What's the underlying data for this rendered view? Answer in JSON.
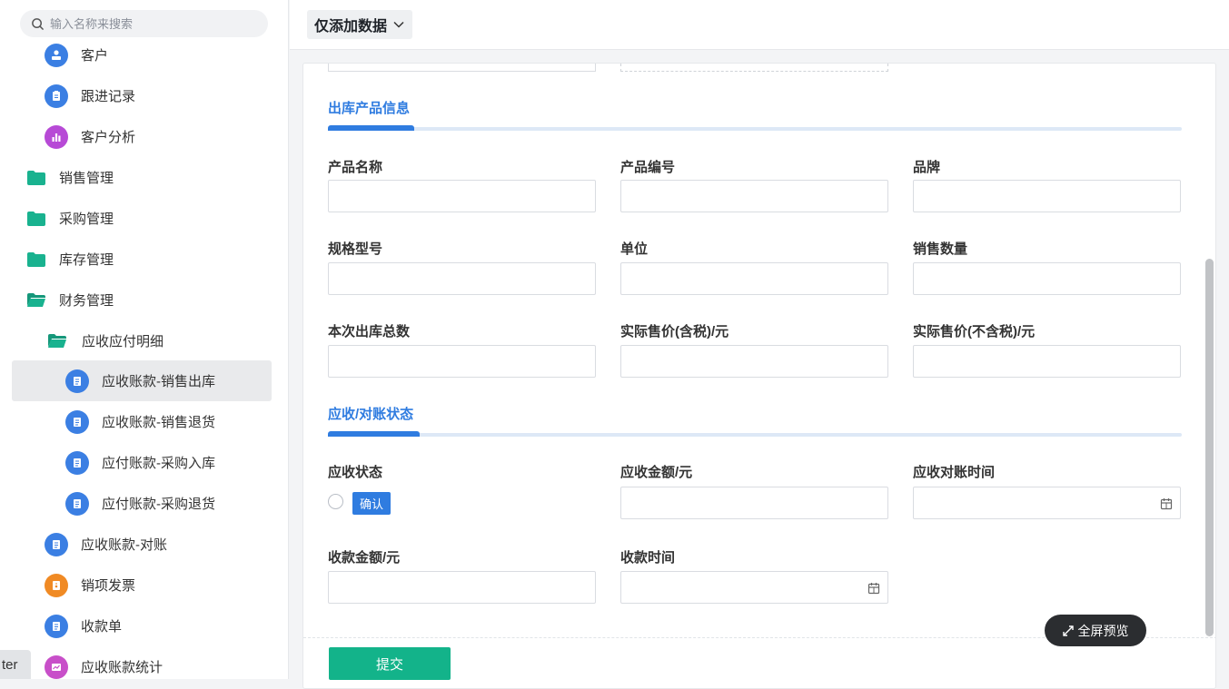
{
  "sidebar": {
    "search_placeholder": "输入名称来搜索",
    "items": [
      {
        "label": "客户",
        "icon": "customer-icon"
      },
      {
        "label": "跟进记录",
        "icon": "clipboard-icon"
      },
      {
        "label": "客户分析",
        "icon": "bar-chart-icon"
      },
      {
        "label": "销售管理",
        "icon": "folder-icon"
      },
      {
        "label": "采购管理",
        "icon": "folder-icon"
      },
      {
        "label": "库存管理",
        "icon": "folder-icon"
      },
      {
        "label": "财务管理",
        "icon": "folder-open-icon"
      },
      {
        "label": "应收应付明细",
        "icon": "folder-open-icon"
      },
      {
        "label": "应收账款-销售出库",
        "icon": "document-icon",
        "active": true
      },
      {
        "label": "应收账款-销售退货",
        "icon": "document-icon"
      },
      {
        "label": "应付账款-采购入库",
        "icon": "document-icon"
      },
      {
        "label": "应付账款-采购退货",
        "icon": "document-icon"
      },
      {
        "label": "应收账款-对账",
        "icon": "document-icon"
      },
      {
        "label": "销项发票",
        "icon": "invoice-icon"
      },
      {
        "label": "收款单",
        "icon": "document-icon"
      },
      {
        "label": "应收账款统计",
        "icon": "chart-icon"
      }
    ],
    "bottom_tag": "ter"
  },
  "topbar": {
    "dropdown_label": "仅添加数据"
  },
  "form": {
    "section1_title": "出库产品信息",
    "product_name_label": "产品名称",
    "product_code_label": "产品编号",
    "brand_label": "品牌",
    "spec_label": "规格型号",
    "unit_label": "单位",
    "sales_qty_label": "销售数量",
    "outbound_total_label": "本次出库总数",
    "price_tax_label": "实际售价(含税)/元",
    "price_notax_label": "实际售价(不含税)/元",
    "section2_title": "应收/对账状态",
    "receivable_status_label": "应收状态",
    "confirm_tag": "确认",
    "receivable_amount_label": "应收金额/元",
    "reconcile_time_label": "应收对账时间",
    "received_amount_label": "收款金额/元",
    "received_time_label": "收款时间",
    "submit_label": "提交"
  },
  "fullscreen_label": "全屏预览",
  "colors": {
    "accent_blue": "#2f7ce0",
    "submit_green": "#13b38a",
    "folder_teal": "#19b28f"
  }
}
